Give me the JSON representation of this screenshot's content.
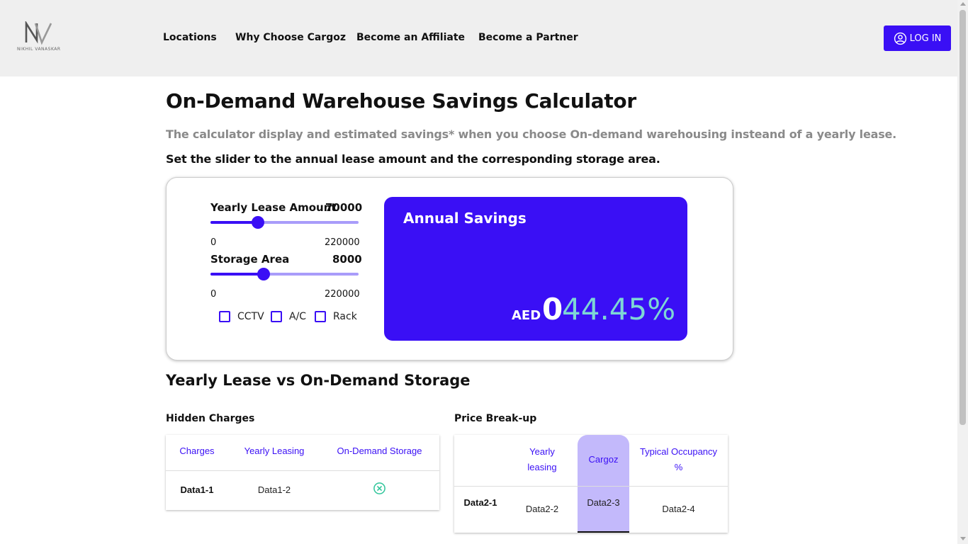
{
  "brand": {
    "logo_text": "NIKHIL VANASKAR"
  },
  "nav": {
    "items": [
      "Locations",
      "Why Choose Cargoz",
      "Become an Affiliate",
      "Become a Partner"
    ],
    "login_label": "LOG IN"
  },
  "calculator": {
    "title": "On-Demand Warehouse Savings Calculator",
    "subtitle": "The calculator display and estimated savings* when you choose On-demand warehousing insteand of a yearly lease.",
    "instruction": "Set the slider to the annual lease amount and the corresponding storage area.",
    "lease_slider": {
      "label": "Yearly Lease Amount",
      "value": "70000",
      "min": "0",
      "max": "220000",
      "fraction": 0.32
    },
    "area_slider": {
      "label": "Storage Area",
      "value": "8000",
      "min": "0",
      "max": "220000",
      "fraction": 0.36
    },
    "checkboxes": [
      {
        "label": "CCTV",
        "checked": false
      },
      {
        "label": "A/C",
        "checked": false
      },
      {
        "label": "Rack",
        "checked": false
      }
    ],
    "savings": {
      "title": "Annual Savings",
      "currency": "AED",
      "amount": "0",
      "percent": "44.45%"
    }
  },
  "comparison": {
    "title": "Yearly Lease vs On-Demand Storage",
    "hidden_charges": {
      "title": "Hidden Charges",
      "headers": [
        "Charges",
        "Yearly Leasing",
        "On-Demand Storage"
      ],
      "row": [
        "Data1-1",
        "Data1-2"
      ],
      "row_icon": "circle-x-icon"
    },
    "price_breakup": {
      "title": "Price Break-up",
      "headers": [
        "Yearly leasing",
        "Cargoz",
        "Typical Occupancy %"
      ],
      "row": [
        "Data2-1",
        "Data2-2",
        "Data2-3",
        "Data2-4"
      ]
    }
  },
  "colors": {
    "accent": "#3a0ff5",
    "accent_light": "#c3b9fb",
    "percent": "#7ed7d5",
    "check_icon": "#2fc59a"
  }
}
